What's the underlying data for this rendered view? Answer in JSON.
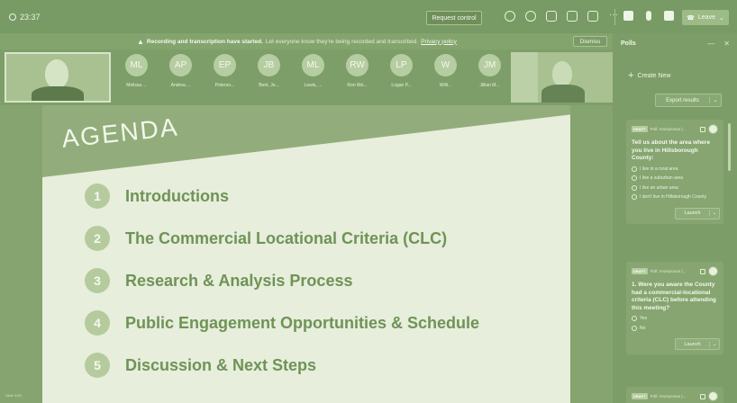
{
  "topbar": {
    "timer": "23:37",
    "request_control": "Request control",
    "leave": "Leave",
    "icons": [
      "people-icon",
      "chat-icon",
      "reactions-icon",
      "view-icon",
      "apps-icon",
      "more-icon",
      "camera-icon",
      "mic-icon",
      "share-icon",
      "phone-icon"
    ]
  },
  "notice": {
    "title": "Recording and transcription have started.",
    "message": "Let everyone know they're being recorded and transcribed.",
    "link": "Privacy policy",
    "dismiss": "Dismiss"
  },
  "participants": [
    {
      "initials": "ML",
      "name": "Melissa ..."
    },
    {
      "initials": "AP",
      "name": "Andrea ..."
    },
    {
      "initials": "EP",
      "name": "Peterso..."
    },
    {
      "initials": "JB",
      "name": "Bent, Je..."
    },
    {
      "initials": "ML",
      "name": "Lewis, ..."
    },
    {
      "initials": "RW",
      "name": "Ron Wo..."
    },
    {
      "initials": "LP",
      "name": "Logan P..."
    },
    {
      "initials": "W",
      "name": "Willi..."
    },
    {
      "initials": "JM",
      "name": "Jillian M..."
    }
  ],
  "slide": {
    "title": "AGENDA",
    "items": [
      {
        "num": "1",
        "text": "Introductions"
      },
      {
        "num": "2",
        "text": "The Commercial Locational Criteria (CLC)"
      },
      {
        "num": "3",
        "text": "Research & Analysis Process"
      },
      {
        "num": "4",
        "text": "Public Engagement Opportunities & Schedule"
      },
      {
        "num": "5",
        "text": "Discussion & Next Steps"
      }
    ]
  },
  "slide_footer_label": "Slide 4/45",
  "polls": {
    "title": "Polls",
    "create_new": "Create New",
    "export": "Export results",
    "cards": [
      {
        "badge": "DRAFT",
        "anon": "Poll: Anonymous |...",
        "question": "Tell us about the area where you live in Hillsborough County:",
        "options": [
          "I live in a rural area",
          "I live a suburban area",
          "I live an urban area",
          "I don't live in Hillsborough County"
        ],
        "launch": "Launch"
      },
      {
        "badge": "DRAFT",
        "anon": "Poll: Anonymous |...",
        "question": "1.    Were you aware the County had a commercial-locational criteria (CLC) before attending this meeting?",
        "options": [
          "Yes",
          "No"
        ],
        "launch": "Launch"
      },
      {
        "badge": "DRAFT",
        "anon": "Poll: Anonymous |...",
        "question": "",
        "options": [],
        "launch": ""
      }
    ]
  }
}
